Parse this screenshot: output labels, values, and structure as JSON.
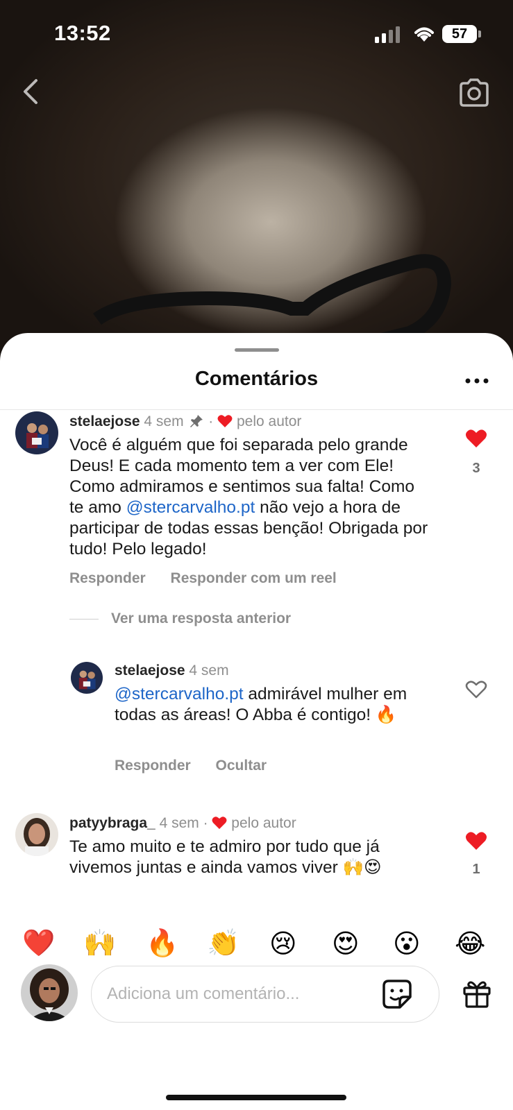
{
  "status_bar": {
    "time": "13:52",
    "battery": "57"
  },
  "sheet": {
    "title": "Comentários"
  },
  "comments": [
    {
      "username": "stelaejose",
      "time": "4 sem",
      "liked_by_author": "pelo autor",
      "text_parts": [
        "Você é alguém que foi separada pelo grande Deus! E cada momento tem a ver com Ele! Como admiramos e sentimos sua falta! Como te amo ",
        "@stercarvalho.pt",
        " não vejo a hora de participar de todas essas benção! Obrigada por tudo! Pelo legado!"
      ],
      "likes": "3",
      "actions": [
        "Responder",
        "Responder com um reel"
      ],
      "view_replies": "Ver uma resposta anterior"
    },
    {
      "username": "stelaejose",
      "time": "4 sem",
      "text_parts": [
        "@stercarvalho.pt",
        " admirável mulher em todas as áreas! O Abba é contigo! 🔥"
      ],
      "actions": [
        "Responder",
        "Ocultar"
      ]
    },
    {
      "username": "patyybraga_",
      "time": "4 sem",
      "liked_by_author": "pelo autor",
      "text": "Te amo muito e te admiro por tudo que já vivemos juntas e ainda vamos viver 🙌😍",
      "likes": "1"
    }
  ],
  "quick_reactions": [
    "❤️",
    "🙌",
    "🔥",
    "👏",
    "😢",
    "😍",
    "😮",
    "😂"
  ],
  "composer": {
    "placeholder": "Adiciona um comentário..."
  },
  "colors": {
    "accent_link": "#1e66c8",
    "like_red": "#ed1c24"
  }
}
